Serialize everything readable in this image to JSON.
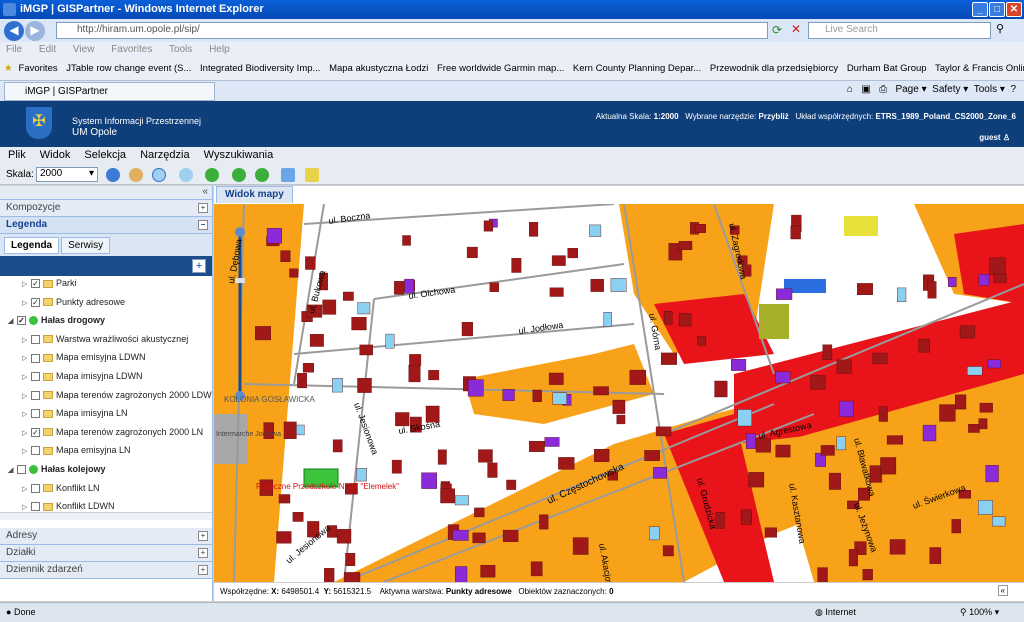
{
  "browser": {
    "title": "iMGP | GISPartner - Windows Internet Explorer",
    "url": "http://hiram.um.opole.pl/sip/",
    "search_placeholder": "Live Search",
    "menu": [
      "File",
      "Edit",
      "View",
      "Favorites",
      "Tools",
      "Help"
    ],
    "favorites_label": "Favorites",
    "favorites": [
      "JTable row change event (S...",
      "Integrated Biodiversity Imp...",
      "Mapa akustyczna Łodzi",
      "Free worldwide Garmin map...",
      "Kern County Planning Depar...",
      "Przewodnik dla przedsiębiorcy",
      "Durham Bat Group",
      "Taylor & Francis Online  Ann..."
    ],
    "tab_title": "iMGP | GISPartner",
    "tools": [
      "Page",
      "Safety",
      "Tools"
    ],
    "status_left": "Done",
    "status_zone": "Internet",
    "zoom": "100%"
  },
  "app": {
    "system_line1": "System Informacji Przestrzennej",
    "system_line2": "UM Opole",
    "scale_label": "Aktualna Skala:",
    "scale_value": "1:2000",
    "tool_label": "Wybrane narzędzie:",
    "tool_value": "Przybliż",
    "crs_label": "Układ współrzędnych:",
    "crs_value": "ETRS_1989_Poland_CS2000_Zone_6",
    "user": "guest",
    "menu": [
      "Plik",
      "Widok",
      "Selekcja",
      "Narzędzia",
      "Wyszukiwania"
    ],
    "toolbar_scale_label": "Skala:",
    "toolbar_scale_value": "2000"
  },
  "left_panel": {
    "kompozycje": "Kompozycje",
    "legenda": "Legenda",
    "tab_legenda": "Legenda",
    "tab_serwisy": "Serwisy",
    "tree": [
      {
        "label": "Parki",
        "checked": true,
        "level": 2
      },
      {
        "label": "Punkty adresowe",
        "checked": true,
        "level": 2
      },
      {
        "label": "Hałas drogowy",
        "checked": true,
        "level": 1,
        "group": true
      },
      {
        "label": "Warstwa wrażliwości akustycznej",
        "checked": false,
        "level": 2
      },
      {
        "label": "Mapa emisyjna LDWN",
        "checked": false,
        "level": 2
      },
      {
        "label": "Mapa imisyjna LDWN",
        "checked": false,
        "level": 2
      },
      {
        "label": "Mapa terenów zagrożonych 2000 LDW",
        "checked": false,
        "level": 2
      },
      {
        "label": "Mapa imisyjna LN",
        "checked": false,
        "level": 2
      },
      {
        "label": "Mapa terenów zagrożonych 2000 LN",
        "checked": true,
        "level": 2
      },
      {
        "label": "Mapa emisyjna LN",
        "checked": false,
        "level": 2
      },
      {
        "label": "Hałas kolejowy",
        "checked": false,
        "level": 1,
        "group": true
      },
      {
        "label": "Konflikt LN",
        "checked": false,
        "level": 2
      },
      {
        "label": "Konflikt LDWN",
        "checked": false,
        "level": 2
      }
    ],
    "adresy": "Adresy",
    "dzialki": "Działki",
    "dziennik": "Dziennik zdarzeń"
  },
  "map": {
    "tab": "Widok mapy",
    "streets": [
      "ul. Boczna",
      "ul. Dębowa",
      "ul. Bukowa",
      "ul. Olchowa",
      "ul. Jodłowa",
      "ul. Górna",
      "ul. Zagrodowa",
      "ul. Jesionowa",
      "ul. Skośna",
      "ul. Częstochowska",
      "ul. Grudzicka",
      "ul. Agrestowa",
      "ul. Kasztanowa",
      "ul. Bławatkowa",
      "ul. Świerkowa",
      "ul. Jeżynowa",
      "ul. Akacjowa",
      "ul. Jesionowa"
    ],
    "poi_school": "Publiczne Przedszkole Nr 37 \"Elemelek\"",
    "poi_market": "Intermarche Jodłowa",
    "poi_district": "KOLONIA GOSŁAWICKA",
    "coords_label": "Współrzędne:",
    "x_label": "X:",
    "x_value": "6498501.4",
    "y_label": "Y:",
    "y_value": "5615321.5",
    "active_layer_label": "Aktywna warstwa:",
    "active_layer_value": "Punkty adresowe",
    "selected_label": "Obiektów zaznaczonych:",
    "selected_value": "0"
  }
}
